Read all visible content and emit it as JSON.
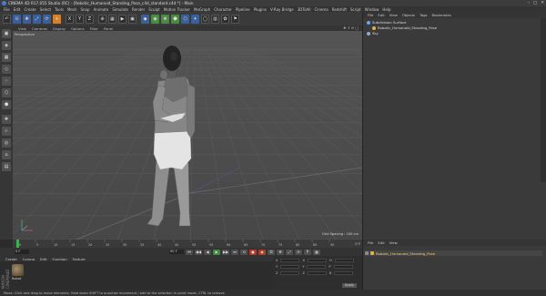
{
  "window": {
    "title": "CINEMA 4D R17.055 Studio (RC) - [Robotic_Humanoid_Standing_Pose_c4d_standard.c4d *] - Main",
    "controls": [
      "–",
      "□",
      "✕"
    ]
  },
  "menubar": {
    "items": [
      "File",
      "Edit",
      "Create",
      "Select",
      "Tools",
      "Mesh",
      "Snap",
      "Animate",
      "Simulate",
      "Render",
      "Sculpt",
      "Motion Tracker",
      "MoGraph",
      "Character",
      "Pipeline",
      "Plugins",
      "V-Ray Bridge",
      "3DToAll",
      "Cinema",
      "Redshift",
      "Script",
      "Window",
      "Help"
    ],
    "layout_label": "Layout:",
    "layout_value": "Startup"
  },
  "toolbar": {
    "buttons": [
      "↶",
      "⊙",
      "✥",
      "⤢",
      "⟳",
      "✛",
      "X",
      "Y",
      "Z",
      "⊕",
      "▦",
      "▶",
      "▣",
      "◆",
      "◉",
      "❋",
      "⬢",
      "⬡",
      "✦",
      "◯",
      "▥",
      "✿",
      "⚑"
    ]
  },
  "viewport": {
    "menu": [
      "View",
      "Cameras",
      "Display",
      "Options",
      "Filter",
      "Panel"
    ],
    "nav": "✥ ↕ ⟳ ▢",
    "label": "Perspective",
    "grid_spacing": "Grid Spacing : 100 cm"
  },
  "timeline": {
    "ticks": [
      "0",
      "5",
      "10",
      "15",
      "20",
      "25",
      "30",
      "35",
      "40",
      "45",
      "50",
      "55",
      "60",
      "65",
      "70",
      "75",
      "80",
      "85",
      "90"
    ],
    "end_label": "0 F"
  },
  "playbar": {
    "start_field": "0 F",
    "end_field": "90 F",
    "buttons": [
      "⏮",
      "◀◀",
      "◀",
      "▶",
      "▶▶",
      "⏭",
      "⟲"
    ]
  },
  "objects": {
    "menu": [
      "File",
      "Edit",
      "View",
      "Objects",
      "Tags",
      "Bookmarks"
    ],
    "rows": [
      {
        "name": "Subdivision Surface",
        "color": "#6aa6e8"
      },
      {
        "name": "Robotic_Humanoid_Standing_Pose",
        "color": "#e0b050"
      },
      {
        "name": "Sky",
        "color": "#9aa8c8"
      }
    ]
  },
  "attributes": {
    "menu": [
      "File",
      "Edit",
      "View"
    ],
    "row_label": "Robotic_Humanoid_Standing_Pose"
  },
  "material": {
    "menu": [
      "Create",
      "Corona",
      "Edit",
      "Function",
      "Texture"
    ],
    "thumb_label": "Robot",
    "logo": "MAXON CINEMA4D"
  },
  "coords": {
    "rows": [
      {
        "a": "X",
        "b": "X",
        "c": "H"
      },
      {
        "a": "Y",
        "b": "Y",
        "c": "P"
      },
      {
        "a": "Z",
        "b": "Z",
        "c": "B"
      }
    ],
    "apply": "Apply"
  },
  "status": "Move: Click and drag to move elements. Hold down SHIFT to quantize movement / add to the selection in point mode, CTRL to remove."
}
